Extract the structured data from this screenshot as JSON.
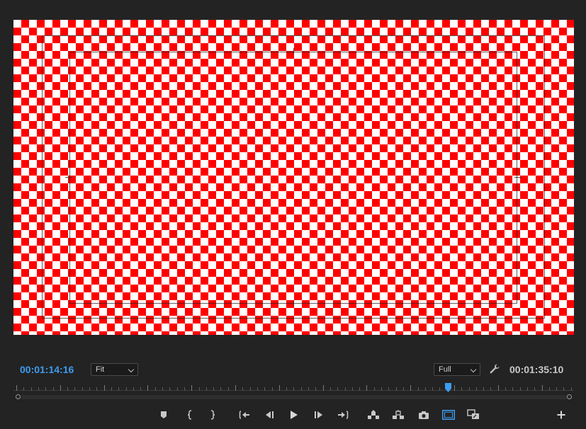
{
  "timecodes": {
    "current": "00:01:14:16",
    "duration": "00:01:35:10"
  },
  "controls": {
    "zoom": "Fit",
    "resolution": "Full"
  },
  "playback": {
    "position_fraction": 0.78
  },
  "colors": {
    "current_timecode": "#3d9cf0",
    "checker_primary": "#ff0000",
    "checker_secondary": "#ffffff",
    "panel_background": "#232323",
    "active_toggle": "#3d9cf0"
  },
  "icons": [
    "add-marker-icon",
    "mark-in-icon",
    "mark-out-icon",
    "go-to-in-icon",
    "step-back-icon",
    "play-icon",
    "step-forward-icon",
    "go-to-out-icon",
    "lift-icon",
    "extract-icon",
    "export-frame-icon",
    "safe-margins-icon",
    "comparison-view-icon",
    "button-editor-add-icon",
    "settings-wrench-icon"
  ]
}
